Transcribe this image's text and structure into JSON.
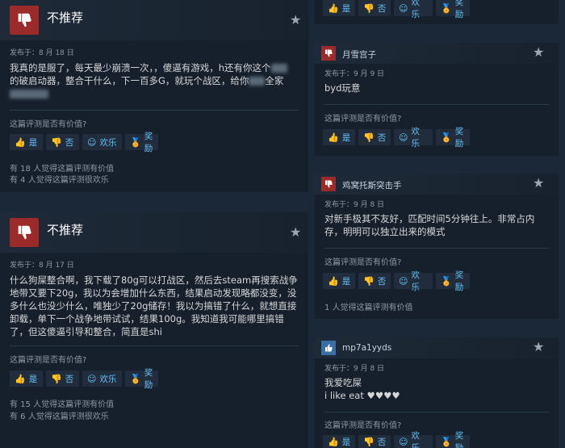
{
  "labels": {
    "helpful_q": "这篇评测是否有价值?",
    "yes": "是",
    "no": "否",
    "funny": "欢乐",
    "award": "奖励"
  },
  "left_reviews": [
    {
      "verdict": "不推荐",
      "posted": "发布于：8 月 18 日",
      "text_l1": "我真的是服了，每天最少崩溃一次，，傻逼有游戏，h还有你这个",
      "text_l2a": "的破启动器，整合干什么，下一百多G，就玩个战区，给你",
      "text_l2b": "全家",
      "stats_1": "有 18 人觉得这篇评测有价值",
      "stats_2": "有 4 人觉得这篇评测很欢乐"
    },
    {
      "verdict": "不推荐",
      "posted": "发布于：8 月 17 日",
      "text": "什么狗屎整合啊，我下载了80g可以打战区，然后去steam再搜索战争地带又要下20g，我以为会增加什么东西，结果启动发现略都没变，没多什么也没少什么，唯独少了20g储存！我以为搞错了什么，就想直接卸载，单下一个战争地带试试，结果100g。我知道我可能哪里搞错了，但这傻逼引导和整合，简直是shi",
      "stats_1": "有 15 人觉得这篇评测有价值",
      "stats_2": "有 6 人觉得这篇评测很欢乐"
    }
  ],
  "right_reviews": [
    {
      "user": "月雪宫子",
      "posted": "发布于：9 月 9 日",
      "text": "byd玩意"
    },
    {
      "user": "鸡窝托斯突击手",
      "posted": "发布于：9 月 8 日",
      "text": "对新手极其不友好，匹配时间5分钟往上。非常占内存，明明可以独立出来的模式",
      "stats": "1 人觉得这篇评测有价值"
    },
    {
      "user": "mp7a1yyds",
      "posted": "发布于：9 月 8 日",
      "text_l1": "我爱吃屎",
      "text_l2": "i like eat ♥♥♥♥"
    }
  ],
  "colors": {
    "background": "#1b2838",
    "card": "#16202d",
    "thumb_down": "#9b2a2a",
    "thumb_up": "#3a6ea5",
    "link": "#67c1f5"
  }
}
